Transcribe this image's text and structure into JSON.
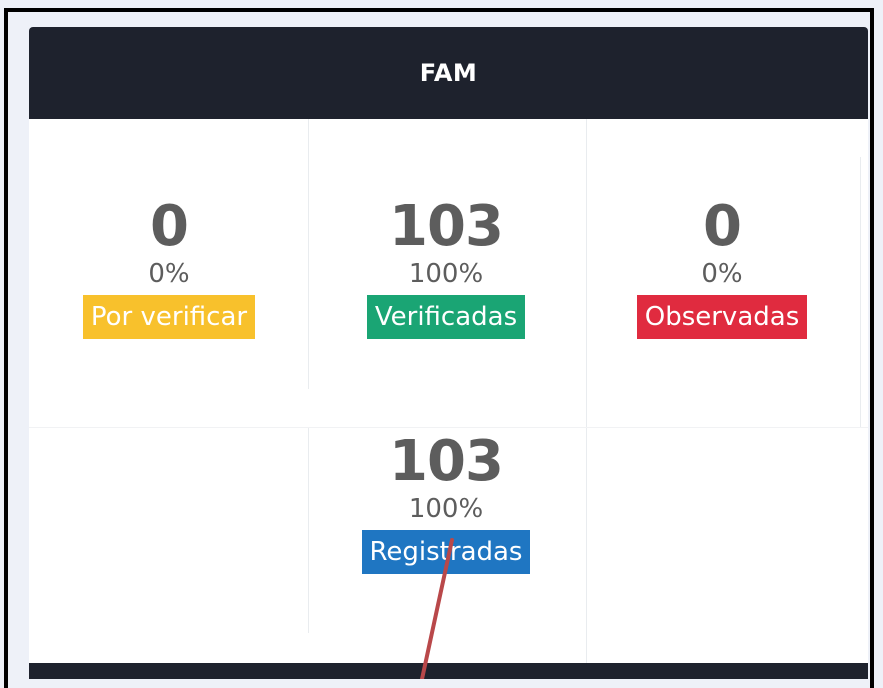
{
  "card": {
    "title": "FAM"
  },
  "stats": {
    "por_verificar": {
      "count": "0",
      "percent": "0%",
      "label": "Por verificar",
      "color": "#f8c12c"
    },
    "verificadas": {
      "count": "103",
      "percent": "100%",
      "label": "Verificadas",
      "color": "#1aa574"
    },
    "observadas": {
      "count": "0",
      "percent": "0%",
      "label": "Observadas",
      "color": "#e02b3f"
    },
    "registradas": {
      "count": "103",
      "percent": "100%",
      "label": "Registradas",
      "color": "#1f76c2"
    }
  },
  "colors": {
    "header_bg": "#1e222d",
    "annotation_arrow": "#b9484a"
  }
}
